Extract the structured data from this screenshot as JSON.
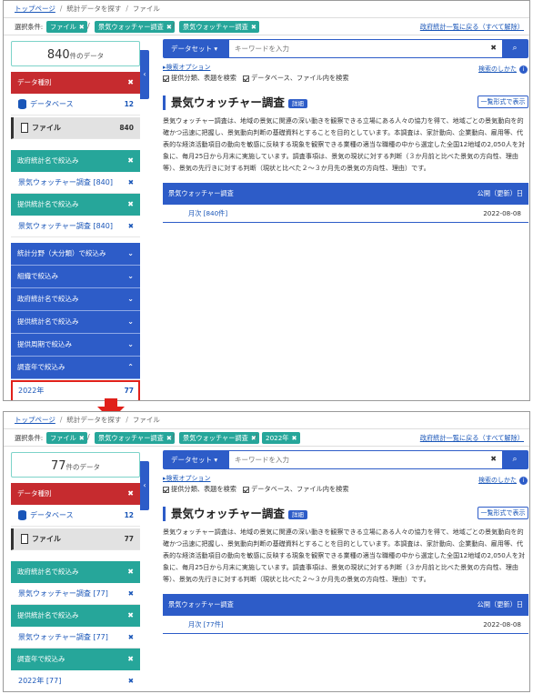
{
  "breadcrumb": {
    "home": "トップページ",
    "search": "統計データを探す",
    "current": "ファイル"
  },
  "conditions": {
    "label": "選択条件:",
    "clear": "政府統計一覧に戻る（すべて解除）"
  },
  "before": {
    "chips": [
      "ファイル",
      "景気ウォッチャー調査",
      "景気ウォッチャー調査"
    ],
    "count_value": "840",
    "count_unit": "件のデータ",
    "data_type_header": "データ種別",
    "database_label": "データベース",
    "database_count": "12",
    "file_label": "ファイル",
    "file_count": "840",
    "filters": [
      {
        "header": "政府統計名で絞込み",
        "value": "景気ウォッチャー調査 [840]"
      },
      {
        "header": "提供統計名で絞込み",
        "value": "景気ウォッチャー調査 [840]"
      }
    ],
    "collapsed": [
      "統計分野（大分類）で絞込み",
      "組織で絞込み",
      "政府統計名で絞込み",
      "提供統計名で絞込み",
      "提供周期で絞込み"
    ],
    "year_header": "調査年で絞込み",
    "year_label": "2022年",
    "year_count": "77",
    "row_label": "月次 [840件]",
    "row_date": "2022-08-08"
  },
  "after": {
    "chips": [
      "ファイル",
      "景気ウォッチャー調査",
      "景気ウォッチャー調査",
      "2022年"
    ],
    "count_value": "77",
    "count_unit": "件のデータ",
    "data_type_header": "データ種別",
    "database_label": "データベース",
    "database_count": "12",
    "file_label": "ファイル",
    "file_count": "77",
    "filters": [
      {
        "header": "政府統計名で絞込み",
        "value": "景気ウォッチャー調査 [77]"
      },
      {
        "header": "提供統計名で絞込み",
        "value": "景気ウォッチャー調査 [77]"
      },
      {
        "header": "調査年で絞込み",
        "value": "2022年 [77]"
      }
    ],
    "row_label": "月次 [77件]",
    "row_date": "2022-08-08"
  },
  "search": {
    "dataset_label": "データセット",
    "placeholder": "キーワードを入力",
    "options": "検索オプション",
    "how": "検索のしかた",
    "check1": "提供分類、表題を検索",
    "check2": "データベース、ファイル内を検索"
  },
  "main": {
    "title": "景気ウォッチャー調査",
    "detail": "詳細",
    "list_format": "一覧形式で表示",
    "description": "景気ウォッチャー調査は、地域の景気に関連の深い動きを観察できる立場にある人々の協力を得て、地域ごとの景気動向を的確かつ迅速に把握し、景気動向判断の基礎資料とすることを目的としています。本調査は、家計動向、企業動向、雇用等、代表的な経済活動項目の動向を敏感に反映する現象を観察できる業種の適当な職種の中から選定した全国12地域の2,050人を対象に、毎月25日から月末に実施しています。調査事項は、景気の現状に対する判断（３か月前と比べた景気の方向性、理由等）、景気の先行きに対する判断（現状と比べた２～３か月先の景気の方向性、理由）です。",
    "col_name": "景気ウォッチャー調査",
    "col_date": "公開（更新）日"
  },
  "colors": {
    "red": "#c62b2f",
    "teal": "#26a69a",
    "blue": "#2d5cc8",
    "link": "#1a56b8",
    "highlight": "#e0201a"
  }
}
